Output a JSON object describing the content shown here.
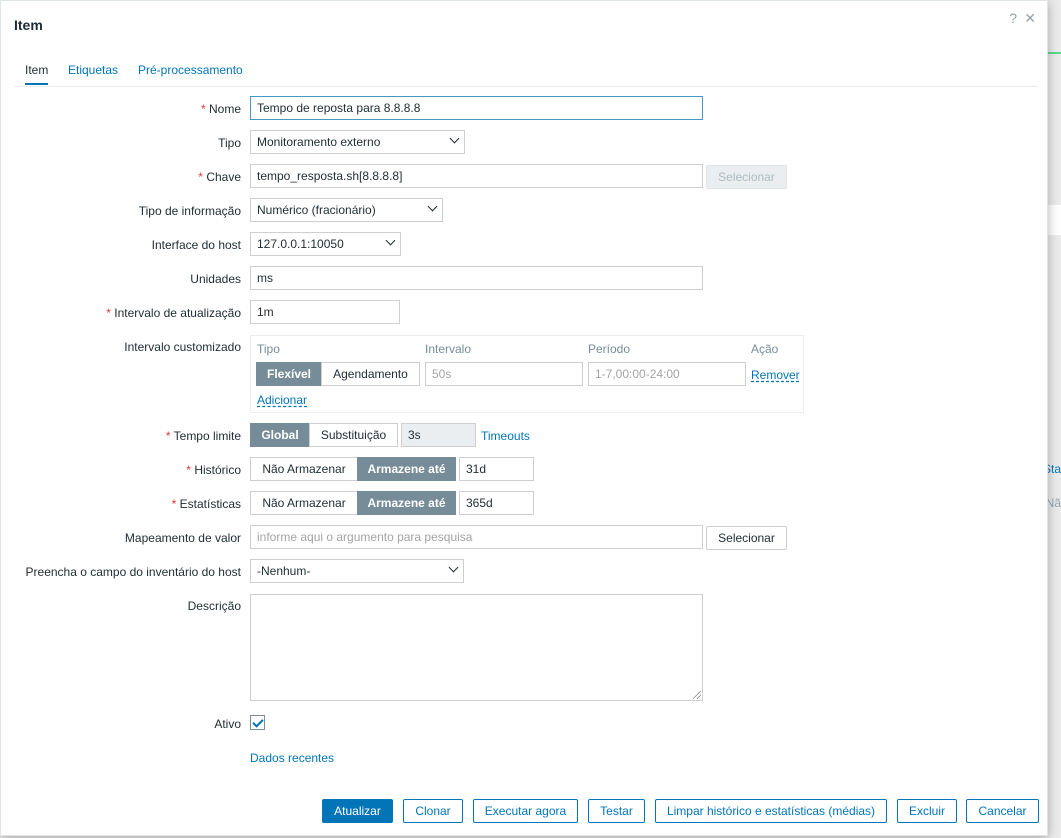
{
  "dialog": {
    "title": "Item",
    "help_icon": "?",
    "close_icon": "✕"
  },
  "tabs": [
    {
      "label": "Item",
      "active": true
    },
    {
      "label": "Etiquetas",
      "active": false
    },
    {
      "label": "Pré-processamento",
      "active": false
    }
  ],
  "form": {
    "nome": {
      "label": "Nome",
      "value": "Tempo de reposta para 8.8.8.8"
    },
    "tipo": {
      "label": "Tipo",
      "value": "Monitoramento externo"
    },
    "chave": {
      "label": "Chave",
      "value": "tempo_resposta.sh[8.8.8.8]",
      "button": "Selecionar"
    },
    "tipo_info": {
      "label": "Tipo de informação",
      "value": "Numérico (fracionário)"
    },
    "interface": {
      "label": "Interface do host",
      "value": "127.0.0.1:10050"
    },
    "unidades": {
      "label": "Unidades",
      "value": "ms"
    },
    "intervalo": {
      "label": "Intervalo de atualização",
      "value": "1m"
    },
    "custom": {
      "label": "Intervalo customizado",
      "headers": {
        "tipo": "Tipo",
        "intervalo": "Intervalo",
        "periodo": "Período",
        "acao": "Ação"
      },
      "flex": "Flexível",
      "agend": "Agendamento",
      "interval_placeholder": "50s",
      "period_placeholder": "1-7,00:00-24:00",
      "remove": "Remover",
      "add": "Adicionar"
    },
    "timeout": {
      "label": "Tempo limite",
      "global": "Global",
      "subst": "Substituição",
      "value": "3s",
      "link": "Timeouts"
    },
    "historico": {
      "label": "Histórico",
      "no": "Não Armazenar",
      "yes": "Armazene até",
      "value": "31d"
    },
    "estatisticas": {
      "label": "Estatísticas",
      "no": "Não Armazenar",
      "yes": "Armazene até",
      "value": "365d"
    },
    "mapeamento": {
      "label": "Mapeamento de valor",
      "placeholder": "informe aqui o argumento para pesquisa",
      "button": "Selecionar"
    },
    "inventario": {
      "label": "Preencha o campo do inventário do host",
      "value": "-Nenhum-"
    },
    "descricao": {
      "label": "Descrição",
      "value": ""
    },
    "ativo": {
      "label": "Ativo",
      "checked": true
    },
    "dados_recentes": "Dados recentes"
  },
  "footer": {
    "atualizar": "Atualizar",
    "clonar": "Clonar",
    "executar": "Executar agora",
    "testar": "Testar",
    "limpar": "Limpar histórico e estatísticas (médias)",
    "excluir": "Excluir",
    "cancelar": "Cancelar"
  },
  "background": {
    "frag_sta": "Sta",
    "frag_na": "Nã"
  }
}
